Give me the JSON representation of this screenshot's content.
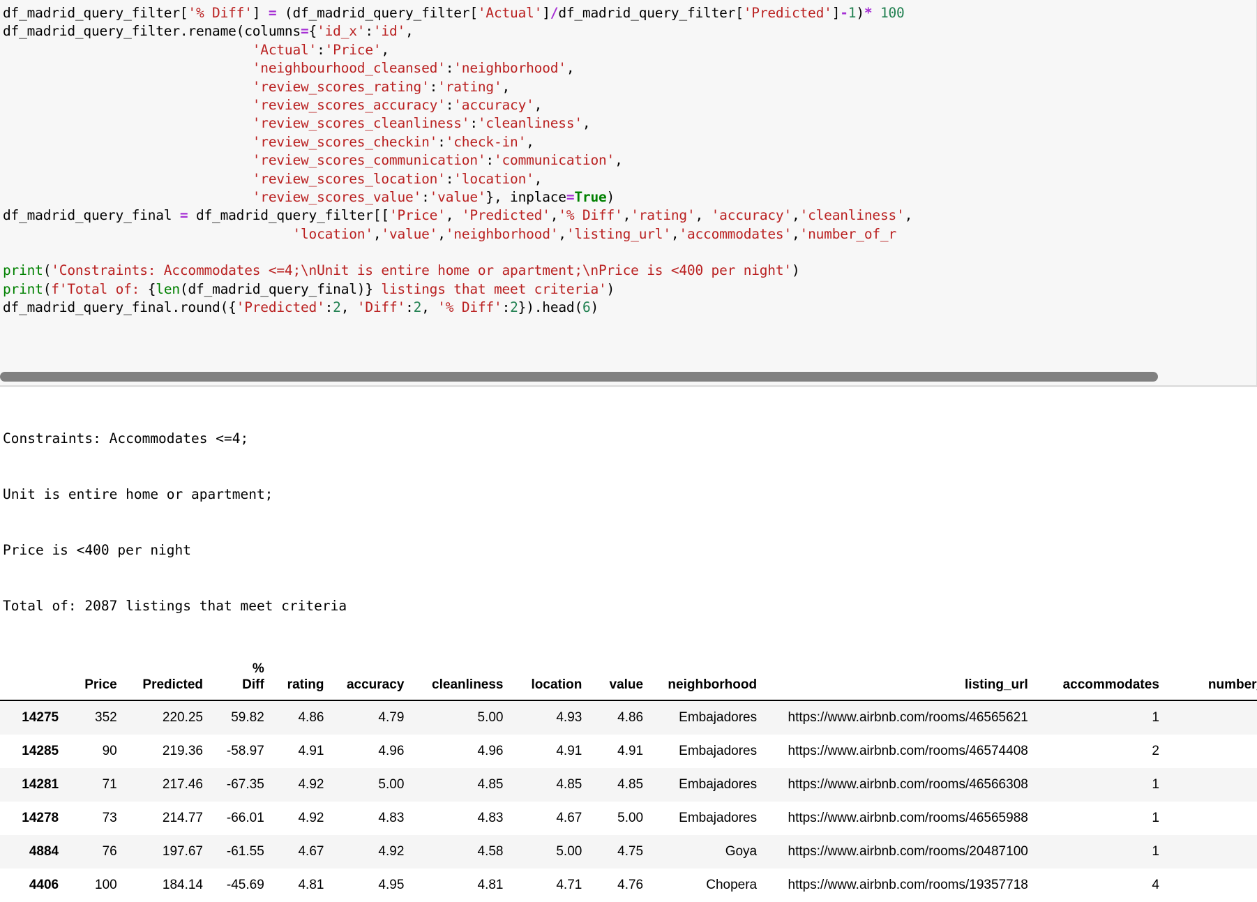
{
  "code_cell": {
    "lines": [
      [
        {
          "t": "df_madrid_query_filter[",
          "c": "plain"
        },
        {
          "t": "'% Diff'",
          "c": "str"
        },
        {
          "t": "]",
          "c": "plain"
        },
        {
          "t": " = ",
          "c": "op"
        },
        {
          "t": "(df_madrid_query_filter[",
          "c": "plain"
        },
        {
          "t": "'Actual'",
          "c": "str"
        },
        {
          "t": "]",
          "c": "plain"
        },
        {
          "t": "/",
          "c": "op"
        },
        {
          "t": "df_madrid_query_filter[",
          "c": "plain"
        },
        {
          "t": "'Predicted'",
          "c": "str"
        },
        {
          "t": "]",
          "c": "plain"
        },
        {
          "t": "-",
          "c": "op"
        },
        {
          "t": "1",
          "c": "num"
        },
        {
          "t": ")",
          "c": "plain"
        },
        {
          "t": "* ",
          "c": "op"
        },
        {
          "t": "100",
          "c": "num"
        }
      ],
      [
        {
          "t": "df_madrid_query_filter.rename(columns",
          "c": "plain"
        },
        {
          "t": "=",
          "c": "op"
        },
        {
          "t": "{",
          "c": "plain"
        },
        {
          "t": "'id_x'",
          "c": "str"
        },
        {
          "t": ":",
          "c": "plain"
        },
        {
          "t": "'id'",
          "c": "str"
        },
        {
          "t": ",",
          "c": "plain"
        }
      ],
      [
        {
          "t": "                               ",
          "c": "plain"
        },
        {
          "t": "'Actual'",
          "c": "str"
        },
        {
          "t": ":",
          "c": "plain"
        },
        {
          "t": "'Price'",
          "c": "str"
        },
        {
          "t": ",",
          "c": "plain"
        }
      ],
      [
        {
          "t": "                               ",
          "c": "plain"
        },
        {
          "t": "'neighbourhood_cleansed'",
          "c": "str"
        },
        {
          "t": ":",
          "c": "plain"
        },
        {
          "t": "'neighborhood'",
          "c": "str"
        },
        {
          "t": ",",
          "c": "plain"
        }
      ],
      [
        {
          "t": "                               ",
          "c": "plain"
        },
        {
          "t": "'review_scores_rating'",
          "c": "str"
        },
        {
          "t": ":",
          "c": "plain"
        },
        {
          "t": "'rating'",
          "c": "str"
        },
        {
          "t": ",",
          "c": "plain"
        }
      ],
      [
        {
          "t": "                               ",
          "c": "plain"
        },
        {
          "t": "'review_scores_accuracy'",
          "c": "str"
        },
        {
          "t": ":",
          "c": "plain"
        },
        {
          "t": "'accuracy'",
          "c": "str"
        },
        {
          "t": ",",
          "c": "plain"
        }
      ],
      [
        {
          "t": "                               ",
          "c": "plain"
        },
        {
          "t": "'review_scores_cleanliness'",
          "c": "str"
        },
        {
          "t": ":",
          "c": "plain"
        },
        {
          "t": "'cleanliness'",
          "c": "str"
        },
        {
          "t": ",",
          "c": "plain"
        }
      ],
      [
        {
          "t": "                               ",
          "c": "plain"
        },
        {
          "t": "'review_scores_checkin'",
          "c": "str"
        },
        {
          "t": ":",
          "c": "plain"
        },
        {
          "t": "'check-in'",
          "c": "str"
        },
        {
          "t": ",",
          "c": "plain"
        }
      ],
      [
        {
          "t": "                               ",
          "c": "plain"
        },
        {
          "t": "'review_scores_communication'",
          "c": "str"
        },
        {
          "t": ":",
          "c": "plain"
        },
        {
          "t": "'communication'",
          "c": "str"
        },
        {
          "t": ",",
          "c": "plain"
        }
      ],
      [
        {
          "t": "                               ",
          "c": "plain"
        },
        {
          "t": "'review_scores_location'",
          "c": "str"
        },
        {
          "t": ":",
          "c": "plain"
        },
        {
          "t": "'location'",
          "c": "str"
        },
        {
          "t": ",",
          "c": "plain"
        }
      ],
      [
        {
          "t": "                               ",
          "c": "plain"
        },
        {
          "t": "'review_scores_value'",
          "c": "str"
        },
        {
          "t": ":",
          "c": "plain"
        },
        {
          "t": "'value'",
          "c": "str"
        },
        {
          "t": "}, inplace",
          "c": "plain"
        },
        {
          "t": "=",
          "c": "op"
        },
        {
          "t": "True",
          "c": "kw"
        },
        {
          "t": ")",
          "c": "plain"
        }
      ],
      [
        {
          "t": "df_madrid_query_final ",
          "c": "plain"
        },
        {
          "t": "=",
          "c": "op"
        },
        {
          "t": " df_madrid_query_filter[[",
          "c": "plain"
        },
        {
          "t": "'Price'",
          "c": "str"
        },
        {
          "t": ", ",
          "c": "plain"
        },
        {
          "t": "'Predicted'",
          "c": "str"
        },
        {
          "t": ",",
          "c": "plain"
        },
        {
          "t": "'% Diff'",
          "c": "str"
        },
        {
          "t": ",",
          "c": "plain"
        },
        {
          "t": "'rating'",
          "c": "str"
        },
        {
          "t": ", ",
          "c": "plain"
        },
        {
          "t": "'accuracy'",
          "c": "str"
        },
        {
          "t": ",",
          "c": "plain"
        },
        {
          "t": "'cleanliness'",
          "c": "str"
        },
        {
          "t": ",",
          "c": "plain"
        }
      ],
      [
        {
          "t": "                                    ",
          "c": "plain"
        },
        {
          "t": "'location'",
          "c": "str"
        },
        {
          "t": ",",
          "c": "plain"
        },
        {
          "t": "'value'",
          "c": "str"
        },
        {
          "t": ",",
          "c": "plain"
        },
        {
          "t": "'neighborhood'",
          "c": "str"
        },
        {
          "t": ",",
          "c": "plain"
        },
        {
          "t": "'listing_url'",
          "c": "str"
        },
        {
          "t": ",",
          "c": "plain"
        },
        {
          "t": "'accommodates'",
          "c": "str"
        },
        {
          "t": ",",
          "c": "plain"
        },
        {
          "t": "'number_of_r",
          "c": "str"
        }
      ],
      [],
      [
        {
          "t": "print",
          "c": "builtin"
        },
        {
          "t": "(",
          "c": "plain"
        },
        {
          "t": "'Constraints: Accommodates <=4;\\nUnit is entire home or apartment;\\nPrice is <400 per night'",
          "c": "str"
        },
        {
          "t": ")",
          "c": "plain"
        }
      ],
      [
        {
          "t": "print",
          "c": "builtin"
        },
        {
          "t": "(",
          "c": "plain"
        },
        {
          "t": "f'Total of: ",
          "c": "str"
        },
        {
          "t": "{",
          "c": "plain"
        },
        {
          "t": "len",
          "c": "builtin"
        },
        {
          "t": "(df_madrid_query_final)",
          "c": "plain"
        },
        {
          "t": "}",
          "c": "plain"
        },
        {
          "t": " listings that meet criteria'",
          "c": "str"
        },
        {
          "t": ")",
          "c": "plain"
        }
      ],
      [
        {
          "t": "df_madrid_query_final.round({",
          "c": "plain"
        },
        {
          "t": "'Predicted'",
          "c": "str"
        },
        {
          "t": ":",
          "c": "plain"
        },
        {
          "t": "2",
          "c": "num"
        },
        {
          "t": ", ",
          "c": "plain"
        },
        {
          "t": "'Diff'",
          "c": "str"
        },
        {
          "t": ":",
          "c": "plain"
        },
        {
          "t": "2",
          "c": "num"
        },
        {
          "t": ", ",
          "c": "plain"
        },
        {
          "t": "'% Diff'",
          "c": "str"
        },
        {
          "t": ":",
          "c": "plain"
        },
        {
          "t": "2",
          "c": "num"
        },
        {
          "t": "}).head(",
          "c": "plain"
        },
        {
          "t": "6",
          "c": "num"
        },
        {
          "t": ")",
          "c": "plain"
        }
      ]
    ],
    "scrollbar": {
      "thumb_color": "#808080",
      "orientation": "horizontal"
    }
  },
  "stdout": {
    "text": "Constraints: Accommodates <=4;\nUnit is entire home or apartment;\nPrice is <400 per night\nTotal of: 2087 listings that meet criteria",
    "constraints_line": "Constraints: Accommodates <=4;",
    "unit_line": "Unit is entire home or apartment;",
    "price_line": "Price is <400 per night",
    "total_line": "Total of: 2087 listings that meet criteria",
    "total_count": "2087"
  },
  "dataframe": {
    "index_header": "",
    "columns": [
      "Price",
      "Predicted",
      "% Diff",
      "rating",
      "accuracy",
      "cleanliness",
      "location",
      "value",
      "neighborhood",
      "listing_url",
      "accommodates",
      "number_of_r"
    ],
    "pct_diff_line1": "%",
    "pct_diff_line2": "Diff",
    "rows": [
      {
        "index": "14275",
        "Price": "352",
        "Predicted": "220.25",
        "pct_diff": "59.82",
        "rating": "4.86",
        "accuracy": "4.79",
        "cleanliness": "5.00",
        "location": "4.93",
        "value": "4.86",
        "neighborhood": "Embajadores",
        "listing_url": "https://www.airbnb.com/rooms/46565621",
        "accommodates": "1",
        "number_of_r": ""
      },
      {
        "index": "14285",
        "Price": "90",
        "Predicted": "219.36",
        "pct_diff": "-58.97",
        "rating": "4.91",
        "accuracy": "4.96",
        "cleanliness": "4.96",
        "location": "4.91",
        "value": "4.91",
        "neighborhood": "Embajadores",
        "listing_url": "https://www.airbnb.com/rooms/46574408",
        "accommodates": "2",
        "number_of_r": ""
      },
      {
        "index": "14281",
        "Price": "71",
        "Predicted": "217.46",
        "pct_diff": "-67.35",
        "rating": "4.92",
        "accuracy": "5.00",
        "cleanliness": "4.85",
        "location": "4.85",
        "value": "4.85",
        "neighborhood": "Embajadores",
        "listing_url": "https://www.airbnb.com/rooms/46566308",
        "accommodates": "1",
        "number_of_r": ""
      },
      {
        "index": "14278",
        "Price": "73",
        "Predicted": "214.77",
        "pct_diff": "-66.01",
        "rating": "4.92",
        "accuracy": "4.83",
        "cleanliness": "4.83",
        "location": "4.67",
        "value": "5.00",
        "neighborhood": "Embajadores",
        "listing_url": "https://www.airbnb.com/rooms/46565988",
        "accommodates": "1",
        "number_of_r": ""
      },
      {
        "index": "4884",
        "Price": "76",
        "Predicted": "197.67",
        "pct_diff": "-61.55",
        "rating": "4.67",
        "accuracy": "4.92",
        "cleanliness": "4.58",
        "location": "5.00",
        "value": "4.75",
        "neighborhood": "Goya",
        "listing_url": "https://www.airbnb.com/rooms/20487100",
        "accommodates": "1",
        "number_of_r": ""
      },
      {
        "index": "4406",
        "Price": "100",
        "Predicted": "184.14",
        "pct_diff": "-45.69",
        "rating": "4.81",
        "accuracy": "4.95",
        "cleanliness": "4.81",
        "location": "4.71",
        "value": "4.76",
        "neighborhood": "Chopera",
        "listing_url": "https://www.airbnb.com/rooms/19357718",
        "accommodates": "4",
        "number_of_r": ""
      }
    ]
  },
  "colors": {
    "cell_background": "#f7f7f7",
    "string_token": "#ba2121",
    "number_token": "#208050",
    "operator_token": "#a630d4",
    "keyword_token": "#008000",
    "scrollbar_thumb": "#808080",
    "row_stripe": "#f5f5f5"
  }
}
